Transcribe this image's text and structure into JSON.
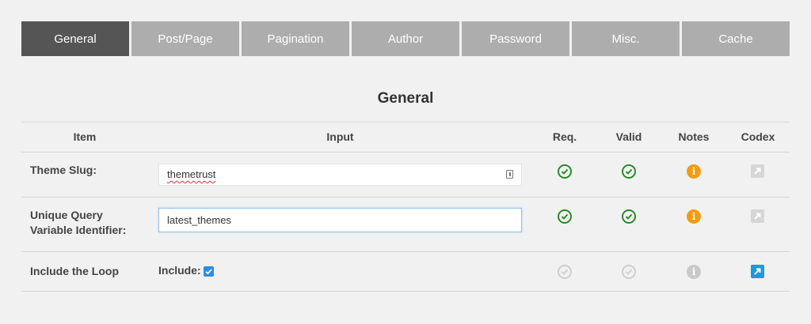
{
  "tabs": [
    {
      "label": "General",
      "active": true
    },
    {
      "label": "Post/Page"
    },
    {
      "label": "Pagination"
    },
    {
      "label": "Author"
    },
    {
      "label": "Password"
    },
    {
      "label": "Misc."
    },
    {
      "label": "Cache"
    }
  ],
  "section_title": "General",
  "table": {
    "headers": {
      "item": "Item",
      "input": "Input",
      "req": "Req.",
      "valid": "Valid",
      "notes": "Notes",
      "codex": "Codex"
    },
    "rows": [
      {
        "label": "Theme Slug:",
        "input_value": "themetrust",
        "req": "ok",
        "valid": "ok",
        "notes": "info",
        "codex": "disabled"
      },
      {
        "label_line1": "Unique Query",
        "label_line2": "Variable Identifier:",
        "input_value": "latest_themes",
        "req": "ok",
        "valid": "ok",
        "notes": "info",
        "codex": "disabled"
      },
      {
        "label": "Include the Loop",
        "include_label": "Include:",
        "include_checked": true,
        "req": "disabled",
        "valid": "disabled",
        "notes": "disabled",
        "codex": "active"
      }
    ]
  },
  "colors": {
    "active_tab": "#555555",
    "tab": "#adadad",
    "check": "#2a8a2a",
    "info": "#f39c12",
    "codex_active": "#1e9ad6"
  },
  "icons": [
    "check-circle-icon",
    "info-icon",
    "external-link-icon",
    "field-menu-icon",
    "checkbox-checked-icon"
  ]
}
